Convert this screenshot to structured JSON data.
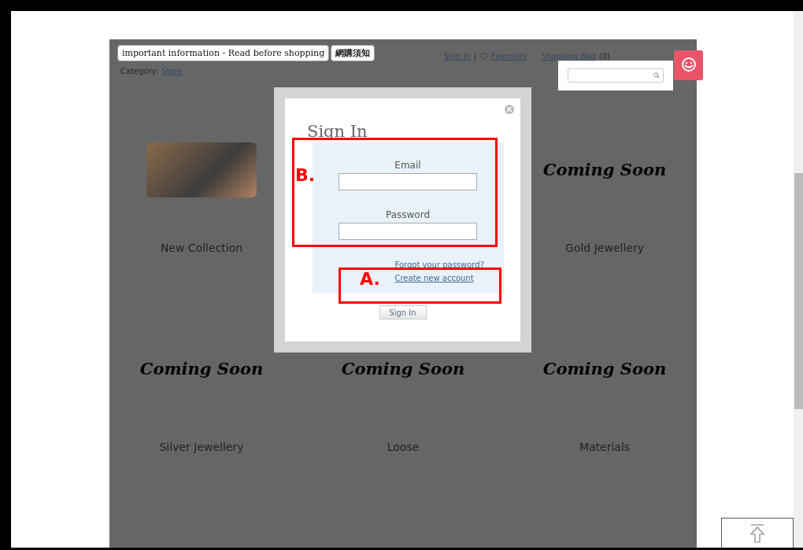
{
  "header": {
    "info_buttons": [
      "important information - Read before shopping",
      "網購須知"
    ],
    "nav": {
      "sign_in": "Sign In",
      "separator": "|",
      "favorites": "Favorites",
      "bag": "Shopping Bag",
      "bag_count": "(0)"
    },
    "category_label": "Category:",
    "category_link": "Store"
  },
  "products": [
    {
      "kind": "photo",
      "label": "New Collection"
    },
    {
      "kind": "coming_soon",
      "image_text": "Coming Soon",
      "label": "Gold Jewellery"
    },
    {
      "kind": "coming_soon",
      "image_text": "Coming Soon",
      "label": "Silver Jewellery"
    },
    {
      "kind": "coming_soon",
      "image_text": "Coming Soon",
      "label": "Loose"
    },
    {
      "kind": "coming_soon",
      "image_text": "Coming Soon",
      "label": "Materials"
    }
  ],
  "dialog": {
    "title": "Sign In",
    "email_label": "Email",
    "password_label": "Password",
    "forgot_link": "Forgot your password?",
    "create_link": "Create new account",
    "submit": "Sign In"
  },
  "annotations": [
    {
      "label": "B."
    },
    {
      "label": "A."
    }
  ]
}
